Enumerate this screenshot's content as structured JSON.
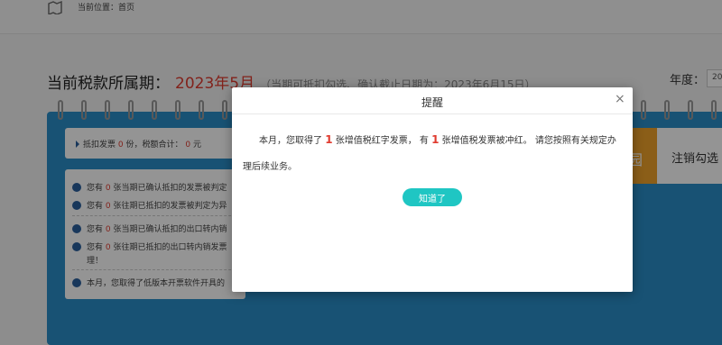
{
  "topbar": {
    "location_label": "当前位置：首页"
  },
  "period": {
    "title": "当前税款所属期：",
    "value": "2023年5月",
    "note": "（当期可抵扣勾选、确认截止日期为：2023年6月15日）",
    "year_label": "年度：",
    "year_value": "20"
  },
  "summary_card": {
    "prefix": "抵扣发票",
    "count": "0",
    "mid": "份，税额合计：",
    "amount": "0",
    "suffix": "元"
  },
  "notices": [
    {
      "prefix": "您有",
      "count": "0",
      "text": "张当期已确认抵扣的发票被判定"
    },
    {
      "prefix": "您有",
      "count": "0",
      "text": "张往期已抵扣的发票被判定为异"
    },
    {
      "prefix": "您有",
      "count": "0",
      "text": "张当期已确认抵扣的出口转内销"
    },
    {
      "prefix": "您有",
      "count": "0",
      "text": "张往期已抵扣的出口转内销发票"
    },
    {
      "text": "理！"
    },
    {
      "text": "本月，您取得了低版本开票软件开具的"
    }
  ],
  "right_buttons": {
    "orange_glyph": "园",
    "cancel_label": "注销勾选"
  },
  "modal": {
    "title": "提醒",
    "close": "×",
    "line1_a": "本月，您取得了",
    "count_red_invoices": "1",
    "line1_b": "张增值税红字发票， 有",
    "count_reversed": "1",
    "line1_c": "张增值税发票被冲红。 请您按照有关规定办",
    "line2": "理后续业务。",
    "ok_label": "知道了"
  },
  "colors": {
    "accent_teal": "#1fc6c3",
    "alert_red": "#e03b2f",
    "panel_blue": "#2a8ec8",
    "orange": "#f0a32a"
  },
  "icons": {
    "location": "map-pin-icon",
    "bullet": "triangle-bullet-icon",
    "notice": "bell-icon",
    "close": "close-icon"
  }
}
